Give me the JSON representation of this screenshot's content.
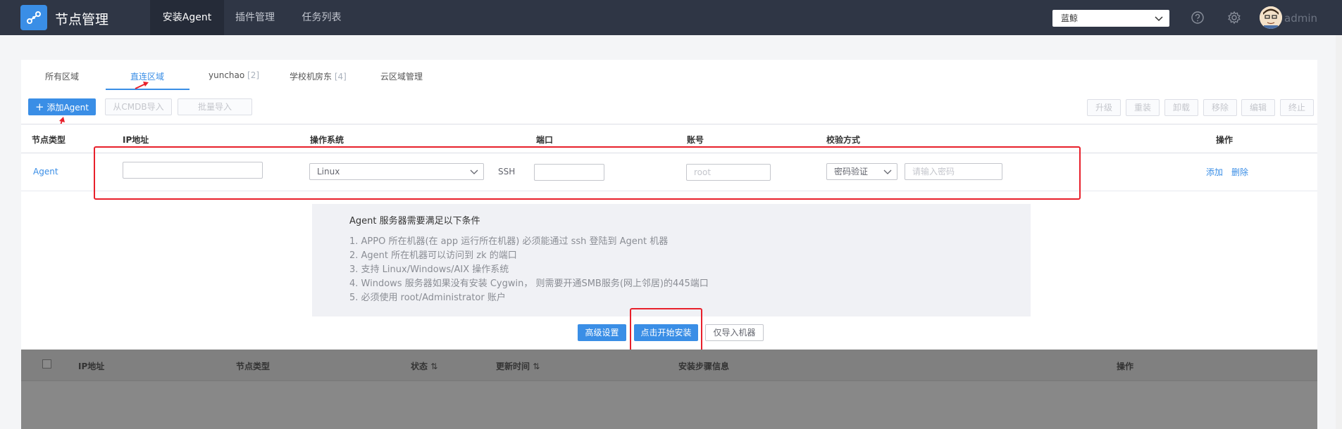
{
  "header": {
    "app_title": "节点管理",
    "nav": [
      "安装Agent",
      "插件管理",
      "任务列表"
    ],
    "region_value": "蓝鲸",
    "username": "admin"
  },
  "tabs": [
    {
      "label": "所有区域",
      "count": ""
    },
    {
      "label": "直连区域",
      "count": ""
    },
    {
      "label": "yunchao",
      "count": "[2]"
    },
    {
      "label": "学校机房东",
      "count": "[4]"
    },
    {
      "label": "云区域管理",
      "count": ""
    }
  ],
  "toolbar": {
    "add_label": "添加Agent",
    "cmdb_import": "从CMDB导入",
    "batch_import": "批量导入",
    "right_buttons": [
      "升级",
      "重装",
      "卸载",
      "移除",
      "编辑",
      "终止"
    ]
  },
  "table": {
    "headers": [
      "节点类型",
      "IP地址",
      "操作系统",
      "端口",
      "账号",
      "校验方式",
      "操作"
    ],
    "row": {
      "node_type": "Agent",
      "ip_value": "",
      "os_value": "Linux",
      "port_label": "SSH",
      "port_value": "",
      "account_placeholder": "root",
      "auth_value": "密码验证",
      "password_placeholder": "请输入密码",
      "actions": [
        "添加",
        "删除"
      ]
    }
  },
  "info": {
    "title": "Agent 服务器需要满足以下条件",
    "lines": [
      "1. APPO 所在机器(在 app 运行所在机器) 必须能通过 ssh 登陆到 Agent 机器",
      "2. Agent 所在机器可以访问到 zk 的端口",
      "3. 支持 Linux/Windows/AIX 操作系统",
      "4. Windows 服务器如果没有安装 Cygwin， 则需要开通SMB服务(网上邻居)的445端口",
      "5. 必须使用 root/Administrator 账户"
    ]
  },
  "actions": {
    "advanced": "高级设置",
    "start_install": "点击开始安装",
    "import_only": "仅导入机器"
  },
  "result_table": {
    "headers": [
      "IP地址",
      "节点类型",
      "状态",
      "更新时间",
      "安装步骤信息",
      "操作"
    ]
  },
  "colors": {
    "topbar": "#2f3645",
    "accent": "#3a8ee6",
    "highlight": "#e8202b"
  }
}
